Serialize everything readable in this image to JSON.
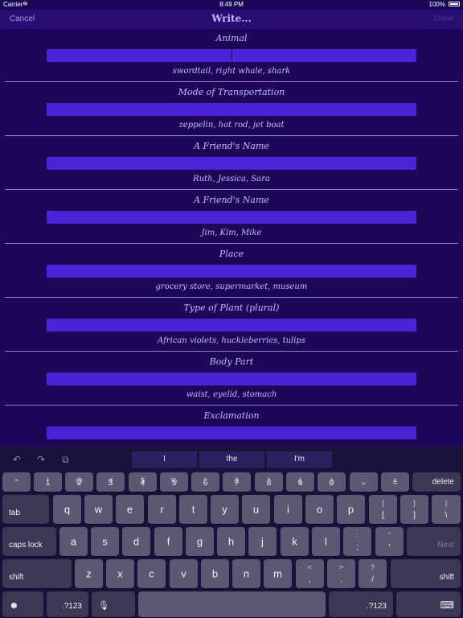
{
  "status_bar": {
    "carrier": "Carrier",
    "wifi_icon": "wifi-icon",
    "time": "8:49 PM",
    "battery": "100%"
  },
  "nav": {
    "cancel": "Cancel",
    "title": "Write...",
    "done": "Done"
  },
  "colors": {
    "background": "#1c0758",
    "nav_bg": "#2a0d73",
    "input_fill": "#4b24d8",
    "text": "#c7b9ff",
    "keyboard_bg": "#17133a",
    "key": "#5a5872",
    "key_dark": "#3a3854"
  },
  "fields": [
    {
      "label": "Animal",
      "hint": "swordtail, right whale, shark",
      "value": ""
    },
    {
      "label": "Mode of Transportation",
      "hint": "zeppelin, hot rod, jet boat",
      "value": ""
    },
    {
      "label": "A Friend's Name",
      "hint": "Ruth, Jessica, Sara",
      "value": ""
    },
    {
      "label": "A Friend's Name",
      "hint": "Jim, Kim, Mike",
      "value": ""
    },
    {
      "label": "Place",
      "hint": "grocery store, supermarket, museum",
      "value": ""
    },
    {
      "label": "Type of Plant (plural)",
      "hint": "African violets, huckleberries, tulips",
      "value": ""
    },
    {
      "label": "Body Part",
      "hint": "waist, eyelid, stomach",
      "value": ""
    },
    {
      "label": "Exclamation",
      "hint": "",
      "value": ""
    }
  ],
  "keyboard": {
    "suggestions": [
      "I",
      "the",
      "I'm"
    ],
    "tools": {
      "undo": "↶",
      "redo": "↷",
      "paste": "⧉"
    },
    "number_row": [
      {
        "top": "~",
        "bottom": "`"
      },
      {
        "top": "!",
        "bottom": "1"
      },
      {
        "top": "@",
        "bottom": "2"
      },
      {
        "top": "#",
        "bottom": "3"
      },
      {
        "top": "$",
        "bottom": "4"
      },
      {
        "top": "%",
        "bottom": "5"
      },
      {
        "top": "^",
        "bottom": "6"
      },
      {
        "top": "&",
        "bottom": "7"
      },
      {
        "top": "*",
        "bottom": "8"
      },
      {
        "top": "(",
        "bottom": "9"
      },
      {
        "top": ")",
        "bottom": "0"
      },
      {
        "top": "_",
        "bottom": "-"
      },
      {
        "top": "+",
        "bottom": "="
      }
    ],
    "delete": "delete",
    "tab": "tab",
    "row_q": [
      "q",
      "w",
      "e",
      "r",
      "t",
      "y",
      "u",
      "i",
      "o",
      "p"
    ],
    "row_q_sym": [
      {
        "top": "{",
        "bottom": "["
      },
      {
        "top": "}",
        "bottom": "]"
      },
      {
        "top": "|",
        "bottom": "\\"
      }
    ],
    "caps_lock": "caps lock",
    "row_a": [
      "a",
      "s",
      "d",
      "f",
      "g",
      "h",
      "j",
      "k",
      "l"
    ],
    "row_a_sym": [
      {
        "top": ":",
        "bottom": ";"
      },
      {
        "top": "\"",
        "bottom": "'"
      }
    ],
    "next": "Next",
    "shift": "shift",
    "row_z": [
      "z",
      "x",
      "c",
      "v",
      "b",
      "n",
      "m"
    ],
    "row_z_sym": [
      {
        "top": "<",
        "bottom": ","
      },
      {
        "top": ">",
        "bottom": "."
      },
      {
        "top": "?",
        "bottom": "/"
      }
    ],
    "emoji": "☻",
    "numbers": ".?123",
    "mic": "🎙",
    "hide": "⌨"
  }
}
